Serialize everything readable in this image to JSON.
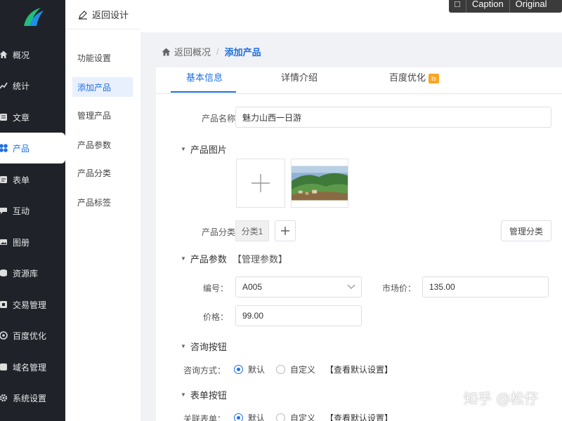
{
  "nav": {
    "items": [
      {
        "label": "概况",
        "icon": "home-icon"
      },
      {
        "label": "统计",
        "icon": "chart-icon"
      },
      {
        "label": "文章",
        "icon": "article-icon"
      },
      {
        "label": "产品",
        "icon": "grid-icon"
      },
      {
        "label": "表单",
        "icon": "form-icon"
      },
      {
        "label": "互动",
        "icon": "chat-icon"
      },
      {
        "label": "图册",
        "icon": "album-icon"
      },
      {
        "label": "资源库",
        "icon": "database-icon"
      },
      {
        "label": "交易管理",
        "icon": "trade-icon"
      },
      {
        "label": "百度优化",
        "icon": "baidu-icon"
      },
      {
        "label": "域名管理",
        "icon": "domain-icon"
      },
      {
        "label": "系统设置",
        "icon": "gear-icon"
      }
    ],
    "active": "产品"
  },
  "sub": {
    "back_label": "返回设计",
    "items": [
      "功能设置",
      "添加产品",
      "管理产品",
      "产品参数",
      "产品分类",
      "产品标签"
    ],
    "active": "添加产品"
  },
  "overlay": {
    "caption": "Caption",
    "original": "Original"
  },
  "breadcrumb": {
    "home": "返回概况",
    "sep": "/",
    "current": "添加产品"
  },
  "tabs": [
    {
      "label": "基本信息",
      "active": true
    },
    {
      "label": "详情介绍",
      "active": false
    },
    {
      "label": "百度优化",
      "active": false,
      "badge": "Is"
    }
  ],
  "form": {
    "name_label": "产品名称：",
    "name_value": "魅力山西一日游",
    "images_section": "产品图片",
    "category_label": "产品分类：",
    "category_tag": "分类1",
    "manage_category_btn": "管理分类",
    "params_section": "产品参数",
    "params_link": "【管理参数】",
    "code_label": "编号：",
    "code_value": "A005",
    "market_price_label": "市场价：",
    "market_price_value": "135.00",
    "price_label": "价格：",
    "price_value": "99.00",
    "consult_section": "咨询按钮",
    "consult_mode_label": "咨询方式：",
    "consult_default": "默认",
    "consult_custom": "自定义",
    "consult_link": "【查看默认设置】",
    "form_section": "表单按钮",
    "form_mode_label": "关联表单：",
    "form_default": "默认",
    "form_custom": "自定义",
    "form_link": "【查看默认设置】"
  },
  "watermark": "知乎 @松仔",
  "colors": {
    "accent": "#1f6fe5",
    "nav_bg": "#1f2329",
    "badge": "#f6a623"
  }
}
